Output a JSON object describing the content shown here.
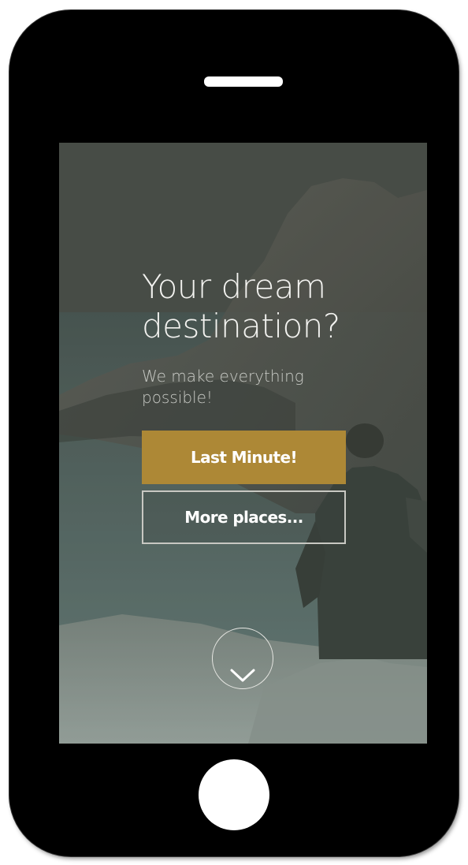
{
  "hero": {
    "title_line1": "Your dream",
    "title_line2": "destination?",
    "subtitle_line1": "We make everything",
    "subtitle_line2": "possible!"
  },
  "buttons": {
    "primary_label": "Last Minute!",
    "secondary_label": "More places..."
  },
  "icons": {
    "scroll": "chevron-down-icon"
  },
  "colors": {
    "accent": "#ad8836",
    "device": "#000000",
    "text": "#f2f2ef"
  }
}
